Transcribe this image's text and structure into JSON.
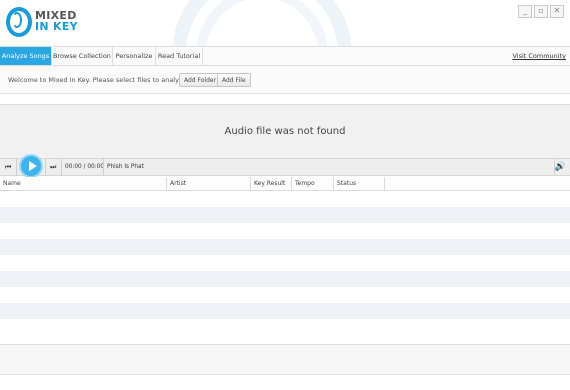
{
  "app": {
    "logo_line1": "MIXED",
    "logo_line2": "IN KEY",
    "brand_color": "#1a9ad6",
    "window_controls": [
      "_",
      "▫",
      "✕"
    ]
  },
  "tabs": [
    {
      "label": "Analyze Songs",
      "active": true
    },
    {
      "label": "Browse Collection",
      "active": false
    },
    {
      "label": "Personalize",
      "active": false
    },
    {
      "label": "Read Tutorial",
      "active": false
    }
  ],
  "visit_link": "Visit Community",
  "toolbar": {
    "welcome": "Welcome to Mixed In Key. Please select files to analyze:",
    "add_folder": "Add Folder",
    "add_file": "Add File"
  },
  "player": {
    "message": "Audio file was not found",
    "time": "00:00 / 00:00",
    "track": "Phish Is Phat",
    "prev_icon": "⏮",
    "next_icon": "⏭",
    "volume_icon": "🔊"
  },
  "table": {
    "columns": [
      "Name",
      "Artist",
      "Key Result",
      "Tempo",
      "Status"
    ],
    "rows": []
  }
}
